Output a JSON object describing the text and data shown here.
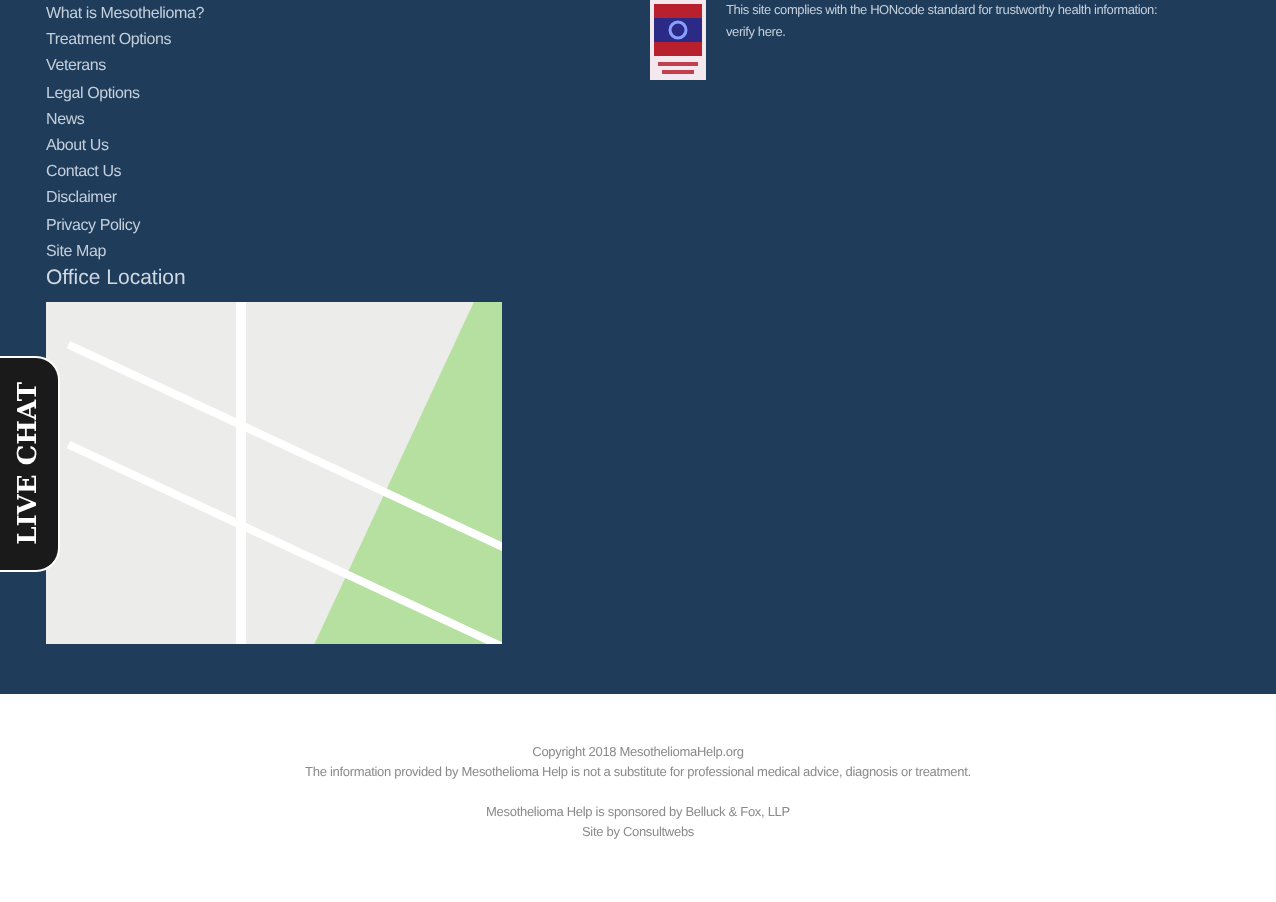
{
  "footer_links": [
    "What is Mesothelioma?",
    "Treatment Options",
    "Veterans",
    "Legal Options",
    "News",
    "About Us",
    "Contact Us",
    "Disclaimer",
    "Privacy Policy",
    "Site Map"
  ],
  "office_heading": "Office Location",
  "honcode": {
    "text": "This site complies with the HONcode standard for trustworthy health information:",
    "link": "verify here."
  },
  "live_chat": "LIVE CHAT",
  "copyright": [
    "Copyright 2018 MesotheliomaHelp.org",
    "The information provided by Mesothelioma Help is not a substitute for professional medical advice, diagnosis or treatment."
  ],
  "credits": [
    "Mesothelioma Help is sponsored by Belluck & Fox, LLP",
    "Site by Consultwebs"
  ]
}
